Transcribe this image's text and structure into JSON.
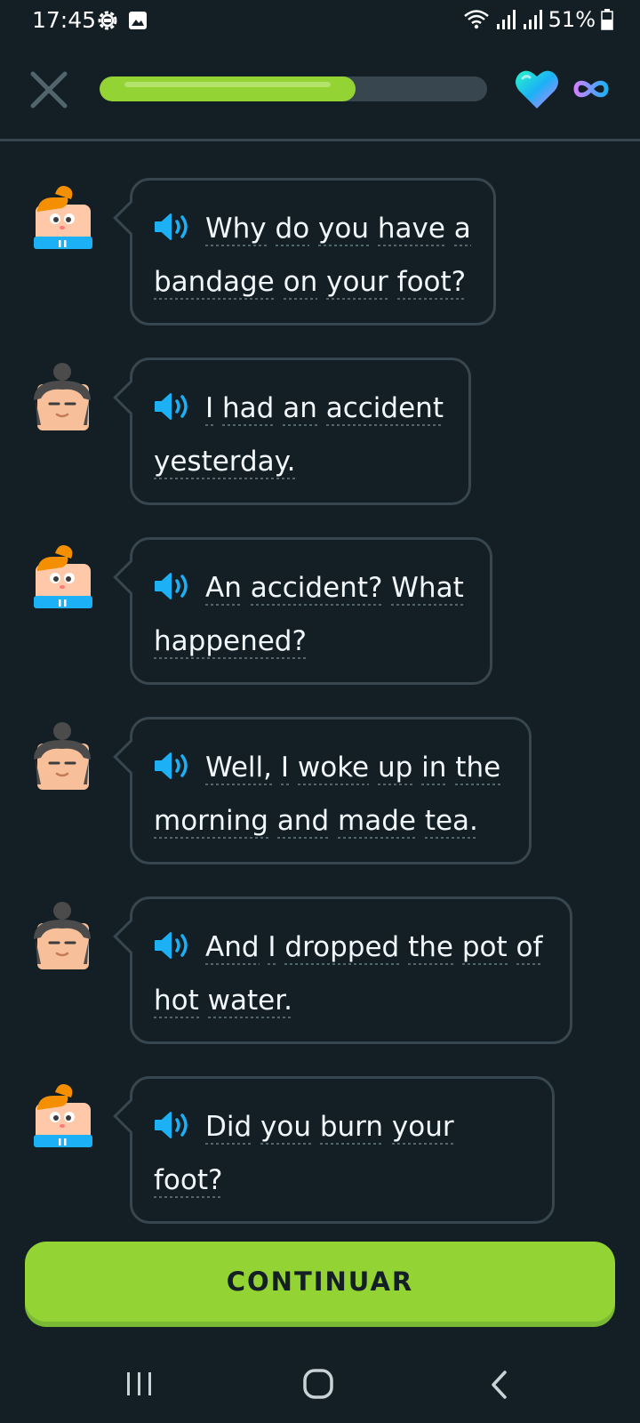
{
  "status_bar": {
    "time": "17:45",
    "battery": "51%",
    "icons": [
      "settings-gear-icon",
      "gallery-icon",
      "wifi-icon",
      "signal-icon",
      "signal-icon",
      "battery-icon"
    ]
  },
  "header": {
    "close_icon": "close-icon",
    "progress_fraction": 0.66,
    "progress_color": "#93d333",
    "track_color": "#37464f",
    "heart_icon": "gradient-heart-icon",
    "hearts_value_icon": "infinity-icon"
  },
  "messages": [
    {
      "speaker": "lily",
      "text": "Why do you have a bandage on your foot?"
    },
    {
      "speaker": "man",
      "text": "I had an accident yesterday."
    },
    {
      "speaker": "lily",
      "text": "An accident? What happened?"
    },
    {
      "speaker": "man",
      "text": "Well, I woke up in the morning and made tea."
    },
    {
      "speaker": "man",
      "text": "And I dropped the pot of hot water."
    },
    {
      "speaker": "lily",
      "text": "Did you burn your foot?"
    }
  ],
  "continue_button": {
    "label": "CONTINUAR",
    "color": "#93d333"
  },
  "nav": {
    "recents": "recents-icon",
    "home": "home-icon",
    "back": "back-icon"
  }
}
